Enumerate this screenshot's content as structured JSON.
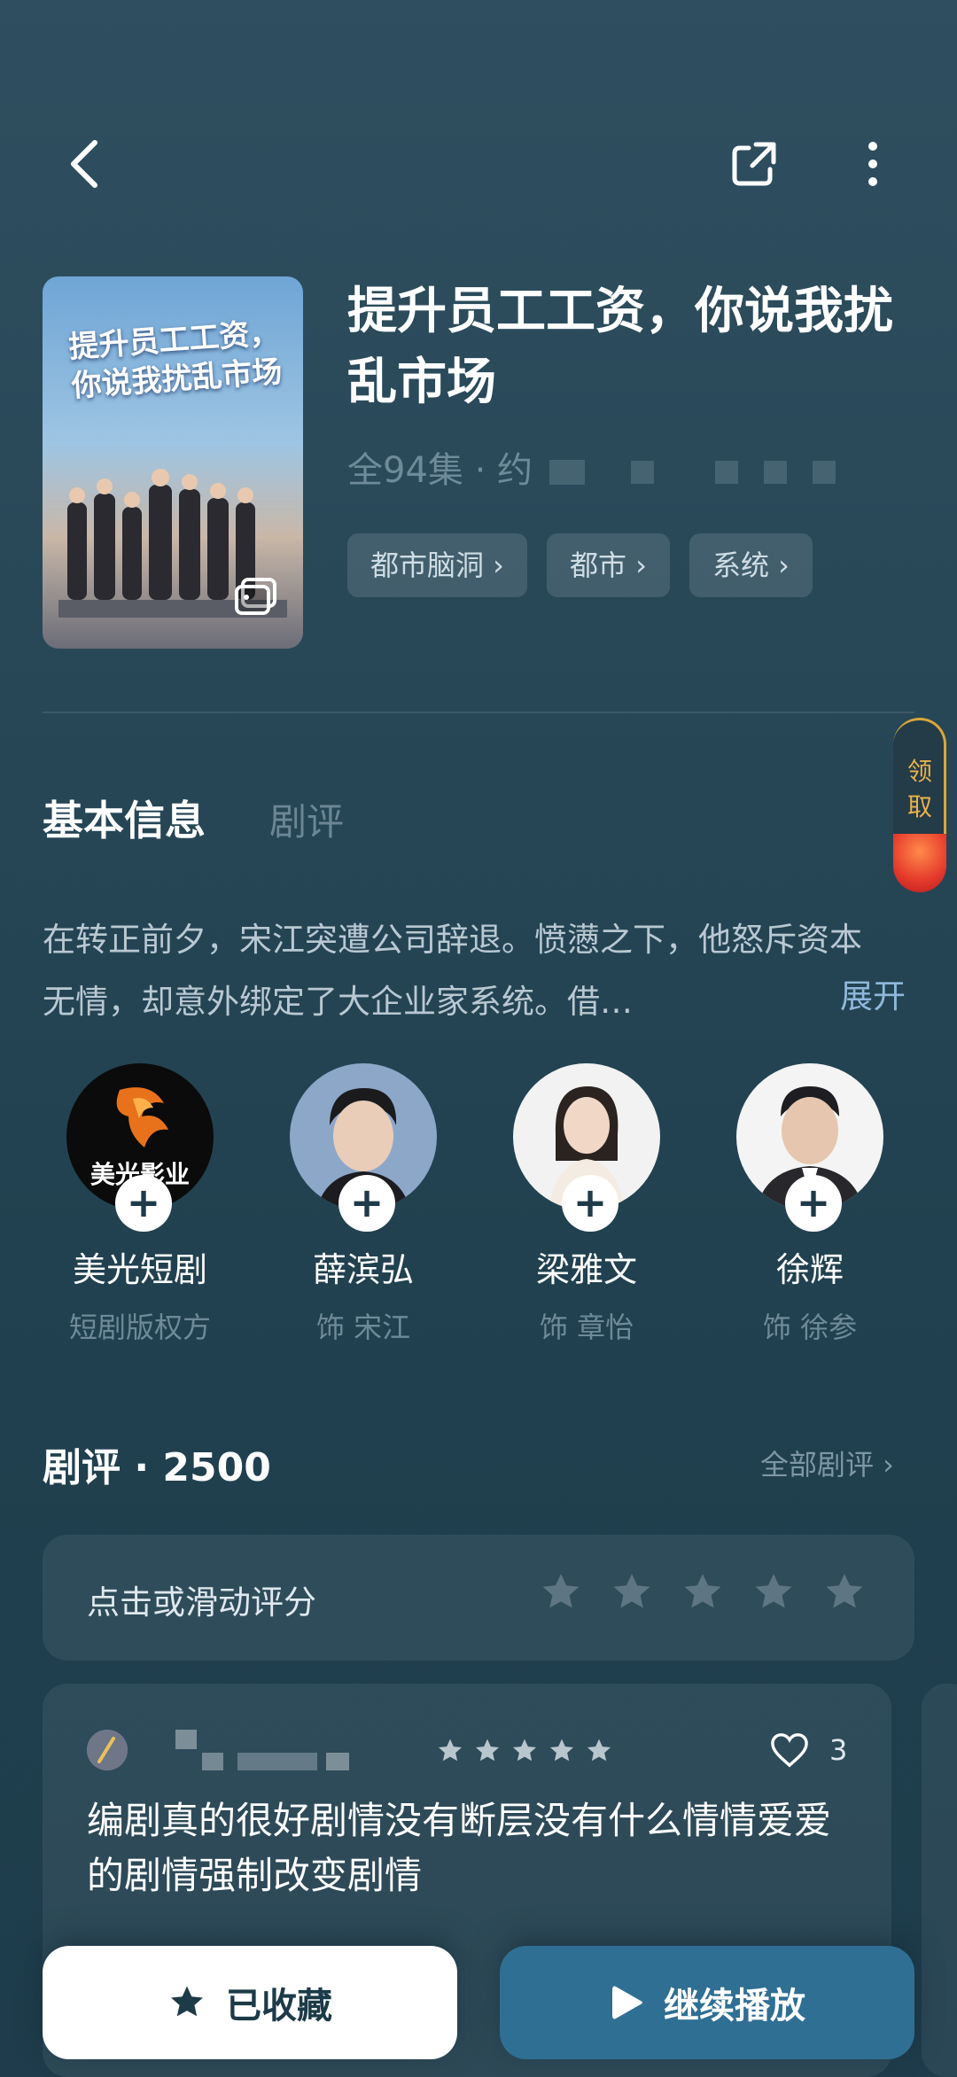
{
  "header": {
    "back_icon": "chevron-left-icon",
    "share_icon": "share-out-icon",
    "more_icon": "more-vertical-icon"
  },
  "drama": {
    "poster_title": "提升员工工资，你说我扰乱市场",
    "title": "提升员工工资，你说我扰乱市场",
    "episodes": "全94集 · 约",
    "tags": [
      "都市脑洞 ›",
      "都市 ›",
      "系统 ›"
    ]
  },
  "reward": {
    "label": "领取"
  },
  "tabs": {
    "info": "基本信息",
    "reviews": "剧评"
  },
  "synopsis": {
    "text": "在转正前夕，宋江突遭公司辞退。愤懑之下，他怒斥资本无情，却意外绑定了大企业家系统。借…",
    "expand": "展开"
  },
  "cast": [
    {
      "name": "美光短剧",
      "role": "短剧版权方",
      "avatar_text": "美光影业"
    },
    {
      "name": "薛滨弘",
      "role": "饰 宋江"
    },
    {
      "name": "梁雅文",
      "role": "饰 章怡"
    },
    {
      "name": "徐辉",
      "role": "饰 徐参"
    }
  ],
  "reviews": {
    "heading": "剧评 · 2500",
    "all_link": "全部剧评 ›",
    "rate_prompt": "点击或滑动评分",
    "rating_stars": 5
  },
  "comment": {
    "stars": 5,
    "likes": "3",
    "text": "编剧真的很好剧情没有断层没有什么情情爱爱的剧情强制改变剧情"
  },
  "actions": {
    "favorite_label": "已收藏",
    "play_label": "继续播放"
  },
  "colors": {
    "background": "#284858",
    "accent_play": "#2f6f93",
    "reward_gold": "#d9a63a"
  }
}
